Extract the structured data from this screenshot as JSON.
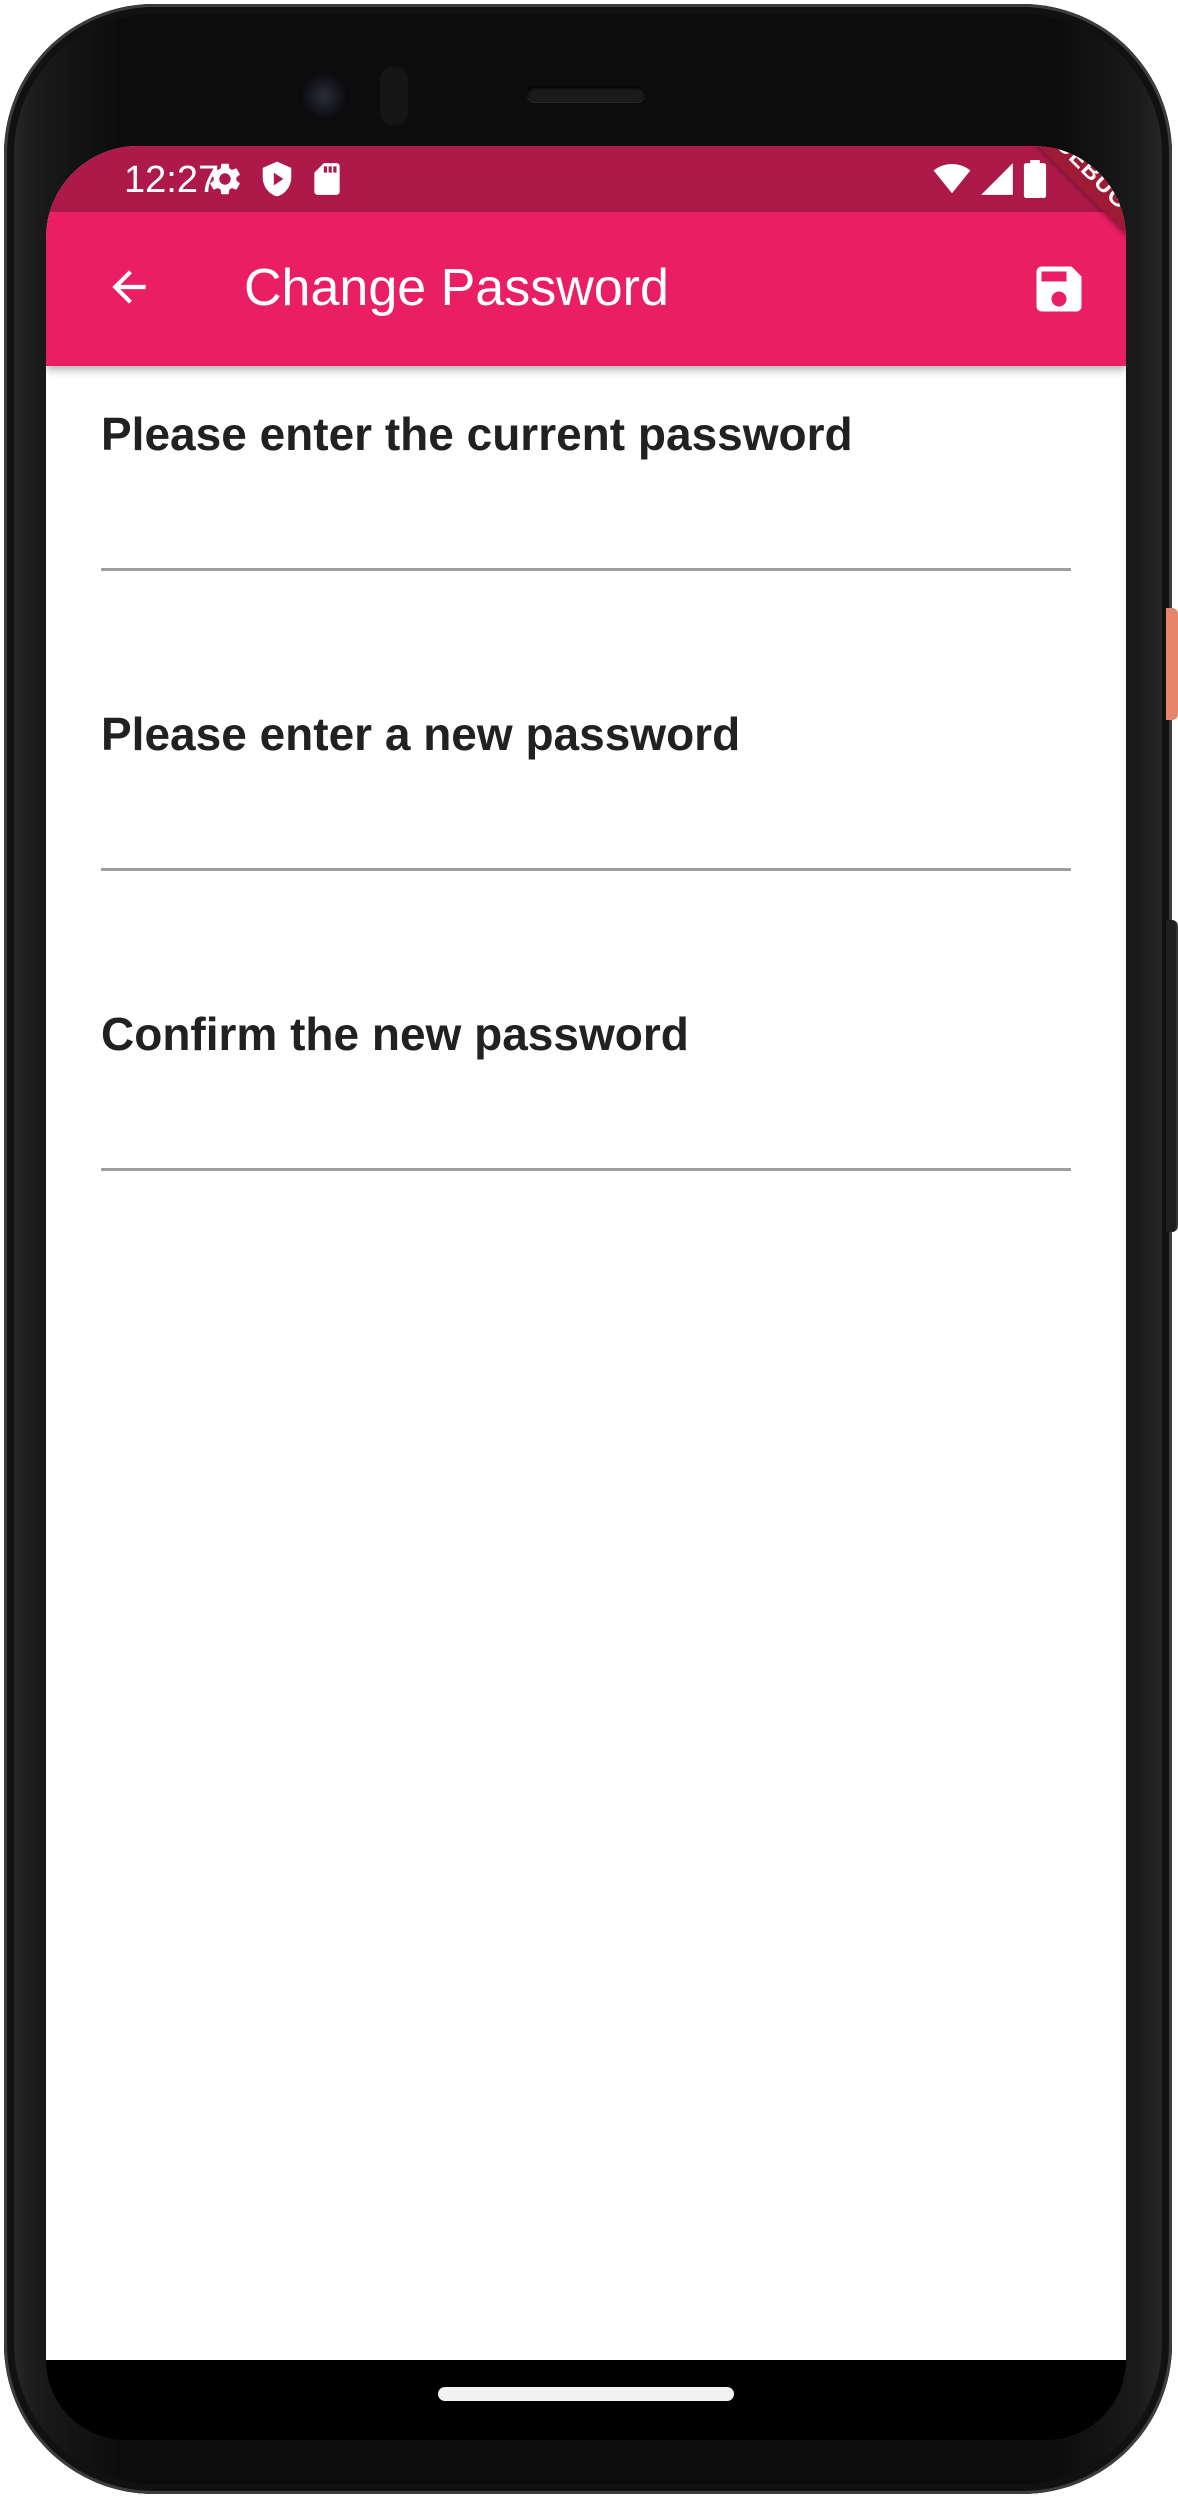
{
  "status_bar": {
    "time": "12:27",
    "left_icons": [
      "gear-icon",
      "shield-icon",
      "sd-card-icon"
    ],
    "right_icons": [
      "wifi-icon",
      "signal-icon",
      "battery-icon"
    ],
    "color": "#ad1a4a"
  },
  "app_bar": {
    "title": "Change Password",
    "back_icon": "arrow-back-icon",
    "save_icon": "floppy-disk-icon",
    "color": "#ea1e63"
  },
  "debug_banner": {
    "label": "DEBUG"
  },
  "form": {
    "fields": [
      {
        "label": "Please enter the current password",
        "value": ""
      },
      {
        "label": "Please enter a new password",
        "value": ""
      },
      {
        "label": "Confirm the new password",
        "value": ""
      }
    ]
  },
  "colors": {
    "accent": "#ea1e63",
    "status_bar": "#ad1a4a",
    "underline": "#9e9e9e",
    "text": "#212121"
  }
}
